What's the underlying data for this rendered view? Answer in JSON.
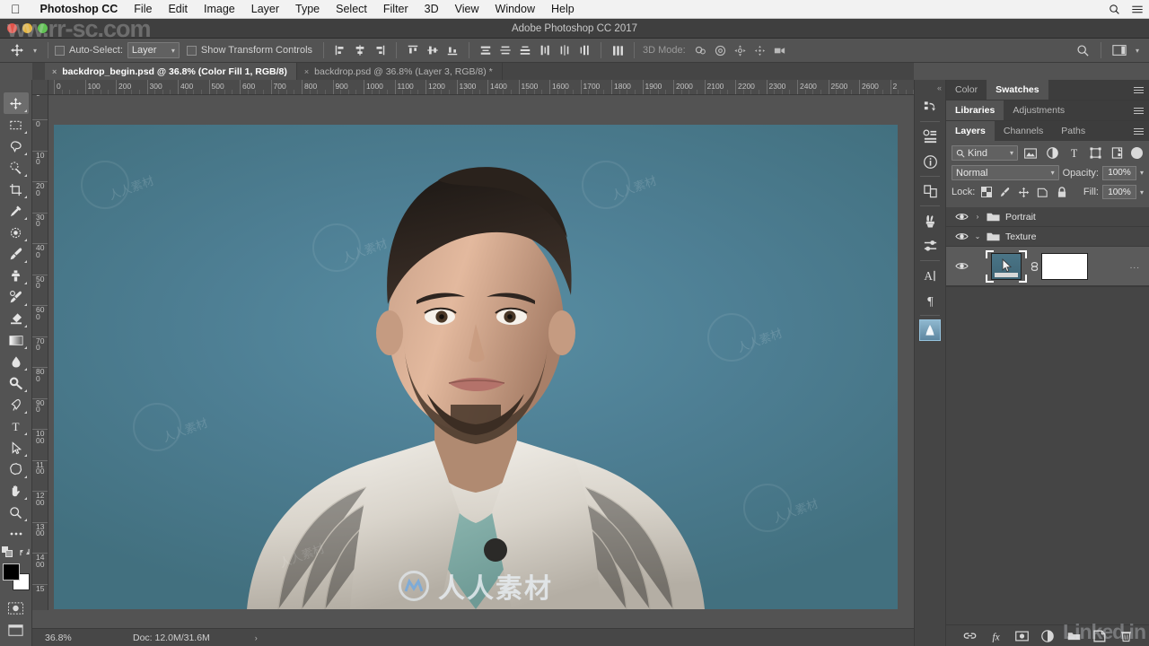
{
  "mac_menu": {
    "apple_icon": "apple-icon",
    "items": [
      {
        "label": "Photoshop CC",
        "bold": true
      },
      {
        "label": "File",
        "bold": false
      },
      {
        "label": "Edit",
        "bold": false
      },
      {
        "label": "Image",
        "bold": false
      },
      {
        "label": "Layer",
        "bold": false
      },
      {
        "label": "Type",
        "bold": false
      },
      {
        "label": "Select",
        "bold": false
      },
      {
        "label": "Filter",
        "bold": false
      },
      {
        "label": "3D",
        "bold": false
      },
      {
        "label": "View",
        "bold": false
      },
      {
        "label": "Window",
        "bold": false
      },
      {
        "label": "Help",
        "bold": false
      }
    ],
    "right_icons": [
      "search-icon",
      "control-center-icon"
    ]
  },
  "window": {
    "title": "Adobe Photoshop CC 2017",
    "traffic_lights": [
      "close-button",
      "minimize-button",
      "zoom-button"
    ],
    "watermark_url": "ww.rr-sc.com"
  },
  "options_bar": {
    "tool_icon": "move-tool-icon",
    "auto_select_label": "Auto-Select:",
    "auto_select_checked": false,
    "auto_select_value": "Layer",
    "show_transform_label": "Show Transform Controls",
    "show_transform_checked": false,
    "align_group_1": [
      "align-left-edges-icon",
      "align-horizontal-centers-icon",
      "align-right-edges-icon",
      "align-top-edges-icon",
      "align-vertical-centers-icon",
      "align-bottom-edges-icon"
    ],
    "align_group_2": [
      "distribute-top-edges-icon",
      "distribute-vertical-centers-icon",
      "distribute-bottom-edges-icon",
      "distribute-left-edges-icon",
      "distribute-horizontal-centers-icon",
      "distribute-right-edges-icon"
    ],
    "more_icon": "distribute-spacing-icon",
    "mode_3d_label": "3D Mode:",
    "mode_3d_icons": [
      "rotate-3d-object-icon",
      "roll-3d-object-icon",
      "drag-3d-object-icon",
      "slide-3d-object-icon",
      "scale-3d-object-icon"
    ],
    "right_icons": [
      "search-icon",
      "workspace-switcher-icon"
    ]
  },
  "document_tabs": [
    {
      "label": "backdrop_begin.psd @ 36.8% (Color Fill 1, RGB/8)",
      "active": true,
      "close": "×"
    },
    {
      "label": "backdrop.psd @ 36.8% (Layer 3, RGB/8) *",
      "active": false,
      "close": "×"
    }
  ],
  "toolbar": {
    "tools": [
      {
        "name": "move-tool",
        "selected": true
      },
      {
        "name": "rectangular-marquee-tool",
        "selected": false
      },
      {
        "name": "lasso-tool",
        "selected": false
      },
      {
        "name": "quick-selection-tool",
        "selected": false
      },
      {
        "name": "crop-tool",
        "selected": false
      },
      {
        "name": "eyedropper-tool",
        "selected": false
      },
      {
        "name": "spot-healing-brush-tool",
        "selected": false
      },
      {
        "name": "brush-tool",
        "selected": false
      },
      {
        "name": "clone-stamp-tool",
        "selected": false
      },
      {
        "name": "history-brush-tool",
        "selected": false
      },
      {
        "name": "eraser-tool",
        "selected": false
      },
      {
        "name": "gradient-tool",
        "selected": false
      },
      {
        "name": "blur-tool",
        "selected": false
      },
      {
        "name": "dodge-tool",
        "selected": false
      },
      {
        "name": "pen-tool",
        "selected": false
      },
      {
        "name": "type-tool",
        "selected": false
      },
      {
        "name": "path-selection-tool",
        "selected": false
      },
      {
        "name": "custom-shape-tool",
        "selected": false
      },
      {
        "name": "hand-tool",
        "selected": false
      },
      {
        "name": "zoom-tool",
        "selected": false
      },
      {
        "name": "edit-toolbar-tool",
        "selected": false
      }
    ],
    "foreground_color": "#000000",
    "background_color": "#ffffff",
    "quick_mask_icon": "quick-mask-icon",
    "screen_mode_icon": "screen-mode-icon"
  },
  "rulers": {
    "horizontal_labels": [
      "0",
      "100",
      "200",
      "300",
      "400",
      "500",
      "600",
      "700",
      "800",
      "900",
      "1000",
      "1100",
      "1200",
      "1300",
      "1400",
      "1500",
      "1600",
      "1700",
      "1800",
      "1900",
      "2000",
      "2100",
      "2200",
      "2300",
      "2400",
      "2500",
      "2600",
      "2"
    ],
    "vertical_labels": [
      "0",
      "0",
      "100",
      "200",
      "300",
      "400",
      "500",
      "600",
      "700",
      "800",
      "900",
      "1000",
      "1100",
      "1200",
      "1300",
      "1400",
      "15"
    ],
    "unit_step": 100
  },
  "canvas": {
    "background_color": "#4c7d92",
    "watermark_text": "人人素材",
    "watermark_logo": "circle-logo-icon",
    "tile_watermark": "人人素材"
  },
  "status_bar": {
    "zoom": "36.8%",
    "doc": "Doc: 12.0M/31.6M",
    "expand_arrow": "›"
  },
  "icon_dock": {
    "collapse_arrow": "«",
    "icons": [
      "history-icon",
      "properties-icon",
      "info-icon",
      "libraries-icon",
      "brush-presets-icon",
      "brush-settings-icon",
      "character-icon",
      "paragraph-icon",
      "image-thumbnail-icon"
    ]
  },
  "panels": {
    "group_color": {
      "tabs": [
        {
          "label": "Color",
          "active": false
        },
        {
          "label": "Swatches",
          "active": true
        }
      ],
      "menu_icon": "panel-menu-icon"
    },
    "group_libraries": {
      "tabs": [
        {
          "label": "Libraries",
          "active": true
        },
        {
          "label": "Adjustments",
          "active": false
        }
      ],
      "menu_icon": "panel-menu-icon"
    },
    "group_layers": {
      "tabs": [
        {
          "label": "Layers",
          "active": true
        },
        {
          "label": "Channels",
          "active": false
        },
        {
          "label": "Paths",
          "active": false
        }
      ],
      "menu_icon": "panel-menu-icon"
    }
  },
  "layers_panel": {
    "filter": {
      "search_icon": "search-icon",
      "kind_label": "Kind",
      "type_filters": [
        "filter-pixel-icon",
        "filter-adjustment-icon",
        "filter-type-icon",
        "filter-shape-icon",
        "filter-smart-object-icon"
      ],
      "toggle_icon": "filter-toggle-icon"
    },
    "blend_mode": "Normal",
    "opacity_label": "Opacity:",
    "opacity_value": "100%",
    "lock_label": "Lock:",
    "lock_icons": [
      "lock-transparent-pixels-icon",
      "lock-image-pixels-icon",
      "lock-position-icon",
      "lock-artboard-icon",
      "lock-all-icon"
    ],
    "fill_label": "Fill:",
    "fill_value": "100%",
    "rows": [
      {
        "name": "Portrait",
        "type": "group",
        "expanded": false,
        "twisty": "›",
        "visible": true,
        "selected": false
      },
      {
        "name": "Texture",
        "type": "group",
        "expanded": true,
        "twisty": "⌄",
        "visible": true,
        "selected": false
      },
      {
        "name": "",
        "type": "layer",
        "visible": true,
        "selected": true,
        "has_mask": true,
        "linked": true,
        "overflow": "..."
      }
    ],
    "footer_icons": [
      "link-layers-icon",
      "layer-style-fx-icon",
      "add-layer-mask-icon",
      "new-adjustment-layer-icon",
      "new-group-icon",
      "new-layer-icon",
      "delete-layer-icon"
    ],
    "watermark": "Linked in"
  }
}
